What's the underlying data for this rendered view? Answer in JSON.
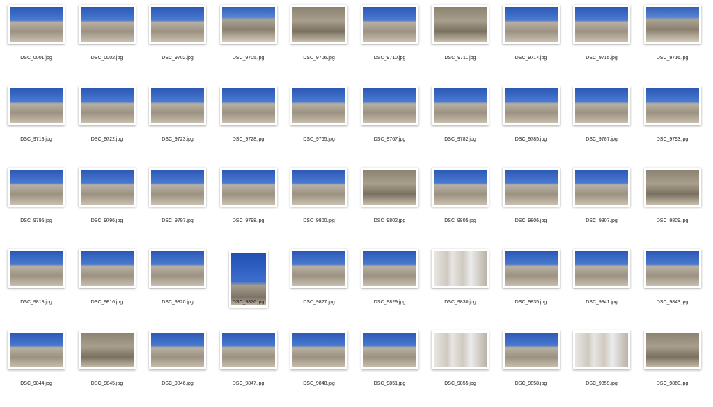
{
  "files": [
    {
      "name": "DSC_0001.jpg"
    },
    {
      "name": "DSC_0002.jpg"
    },
    {
      "name": "DSC_9702.jpg"
    },
    {
      "name": "DSC_9705.jpg"
    },
    {
      "name": "DSC_9706.jpg"
    },
    {
      "name": "DSC_9710.jpg"
    },
    {
      "name": "DSC_9711.jpg"
    },
    {
      "name": "DSC_9714.jpg"
    },
    {
      "name": "DSC_9715.jpg"
    },
    {
      "name": "DSC_9716.jpg"
    },
    {
      "name": "DSC_9718.jpg"
    },
    {
      "name": "DSC_9722.jpg"
    },
    {
      "name": "DSC_9723.jpg"
    },
    {
      "name": "DSC_9728.jpg"
    },
    {
      "name": "DSC_9765.jpg"
    },
    {
      "name": "DSC_9767.jpg"
    },
    {
      "name": "DSC_9782.jpg"
    },
    {
      "name": "DSC_9785.jpg"
    },
    {
      "name": "DSC_9787.jpg"
    },
    {
      "name": "DSC_9793.jpg"
    },
    {
      "name": "DSC_9795.jpg"
    },
    {
      "name": "DSC_9796.jpg"
    },
    {
      "name": "DSC_9797.jpg"
    },
    {
      "name": "DSC_9798.jpg"
    },
    {
      "name": "DSC_9800.jpg"
    },
    {
      "name": "DSC_9802.jpg"
    },
    {
      "name": "DSC_9805.jpg"
    },
    {
      "name": "DSC_9806.jpg"
    },
    {
      "name": "DSC_9807.jpg"
    },
    {
      "name": "DSC_9809.jpg"
    },
    {
      "name": "DSC_9813.jpg"
    },
    {
      "name": "DSC_9816.jpg"
    },
    {
      "name": "DSC_9820.jpg"
    },
    {
      "name": "DSC_9826.jpg",
      "portrait": true
    },
    {
      "name": "DSC_9827.jpg"
    },
    {
      "name": "DSC_9829.jpg"
    },
    {
      "name": "DSC_9830.jpg"
    },
    {
      "name": "DSC_9835.jpg"
    },
    {
      "name": "DSC_9841.jpg"
    },
    {
      "name": "DSC_9843.jpg"
    },
    {
      "name": "DSC_9844.jpg"
    },
    {
      "name": "DSC_9845.jpg"
    },
    {
      "name": "DSC_9846.jpg"
    },
    {
      "name": "DSC_9847.jpg"
    },
    {
      "name": "DSC_9848.jpg"
    },
    {
      "name": "DSC_9851.jpg"
    },
    {
      "name": "DSC_9855.jpg"
    },
    {
      "name": "DSC_9858.jpg"
    },
    {
      "name": "DSC_9859.jpg"
    },
    {
      "name": "DSC_9860.jpg"
    }
  ]
}
